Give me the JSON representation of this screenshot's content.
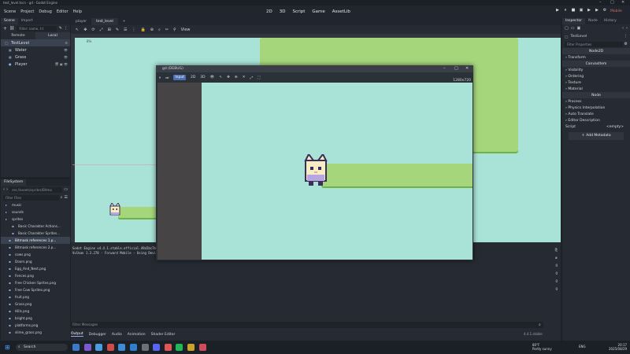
{
  "window": {
    "title": "test_level.tscn - gd - Godot Engine",
    "controls": [
      "–",
      "□",
      "✕"
    ]
  },
  "menubar": {
    "menus": [
      "Scene",
      "Project",
      "Debug",
      "Editor",
      "Help"
    ],
    "workspaces": [
      "2D",
      "3D",
      "Script",
      "Game",
      "AssetLib"
    ],
    "play_icons": [
      "▶",
      "⏸",
      "■",
      "▣",
      "▶",
      "▶",
      "⚙"
    ],
    "renderer": "Mobile"
  },
  "scene_dock": {
    "tabs": [
      "Scene",
      "Import"
    ],
    "filter_placeholder": "Filter: name, t:t",
    "mode_tabs": [
      "Remote",
      "Local"
    ],
    "nodes": [
      {
        "name": "TestLevel",
        "icon": "◯",
        "right": "⚙"
      },
      {
        "name": "Water",
        "icon": "▦",
        "right": "👁"
      },
      {
        "name": "Grass",
        "icon": "▦",
        "right": "👁"
      },
      {
        "name": "Player",
        "icon": "●",
        "right": "🎬 ▣ 👁"
      }
    ]
  },
  "filesystem": {
    "tab": "FileSystem",
    "path": "res://assets/sprites/Bitma",
    "filter_placeholder": "Filter Files",
    "items": [
      {
        "name": "music",
        "kind": "dir"
      },
      {
        "name": "sounds",
        "kind": "dir"
      },
      {
        "name": "sprites",
        "kind": "dir"
      },
      {
        "name": "Basic Charakter Actions...",
        "kind": "sub"
      },
      {
        "name": "Basic Charakter Sprites...",
        "kind": "sub"
      },
      {
        "name": "Bitmask references 1.p...",
        "kind": "sel"
      },
      {
        "name": "Bitmask references 2.p...",
        "kind": "file"
      },
      {
        "name": "cows.png",
        "kind": "file"
      },
      {
        "name": "Doors.png",
        "kind": "file"
      },
      {
        "name": "Egg_And_Nest.png",
        "kind": "file"
      },
      {
        "name": "Fences.png",
        "kind": "file"
      },
      {
        "name": "Free Chicken Sprites.png",
        "kind": "file"
      },
      {
        "name": "Free Cow Sprites.png",
        "kind": "file"
      },
      {
        "name": "fruit.png",
        "kind": "file"
      },
      {
        "name": "Grass.png",
        "kind": "file"
      },
      {
        "name": "Hills.png",
        "kind": "file"
      },
      {
        "name": "bright.png",
        "kind": "file"
      },
      {
        "name": "platforms.png",
        "kind": "file"
      },
      {
        "name": "slime_grass.png",
        "kind": "file"
      }
    ]
  },
  "editor_tabs": [
    "player",
    "test_level",
    "+"
  ],
  "viewport_toolbar": {
    "tools": [
      "↖",
      "✥",
      "⟳",
      "⤢",
      "⊞",
      "✎",
      "☰",
      "⋮",
      "🔒",
      "⊕",
      "⌕",
      "✂",
      "⚲"
    ],
    "view_label": "View"
  },
  "viewport": {
    "zoom": "8%"
  },
  "debug_window": {
    "title": "gd (DEBUG)",
    "tools": [
      "⏸",
      "⏭",
      "Input",
      "2D",
      "3D",
      "👁",
      "↖",
      "✥",
      "⊕",
      "✕",
      "⤢",
      "⛶"
    ],
    "resolution": "1280x720"
  },
  "console": {
    "lines": [
      "Godot Engine v4.4.1.stable.official.49a5bc7b6 - https://godotengine.org",
      "Vulkan 1.3.278 - Forward Mobile - Using Device #0: NVIDIA - NVIDIA GeForce RTX 3070"
    ],
    "filter_placeholder": "Filter Messages",
    "counts": [
      "0",
      "0",
      "0",
      "0"
    ]
  },
  "bottom_tabs": [
    "Output",
    "Debugger",
    "Audio",
    "Animation",
    "Shader Editor"
  ],
  "version": "4.4.1.stable",
  "inspector": {
    "tabs": [
      "Inspector",
      "Node",
      "History"
    ],
    "node": "TestLevel",
    "filter_placeholder": "Filter Properties",
    "classes": [
      "Node2D",
      "CanvasItem",
      "Node"
    ],
    "sections": [
      "Transform",
      "Visibility",
      "Ordering",
      "Texture",
      "Material",
      "Process",
      "Physics Interpolation",
      "Auto Translate",
      "Editor Description"
    ],
    "script_label": "Script",
    "script_value": "<empty>",
    "add_metadata": "Add Metadata"
  },
  "taskbar": {
    "search_placeholder": "Search",
    "weather_temp": "80°F",
    "weather_desc": "Partly sunny",
    "tray": "ENG",
    "time": "20:17",
    "date": "2025/08/29"
  },
  "colors": {
    "water": "#a9e2d6",
    "grass": "#a6d67c",
    "player_body": "#f6eec2",
    "player_outline": "#3b2f5a"
  }
}
